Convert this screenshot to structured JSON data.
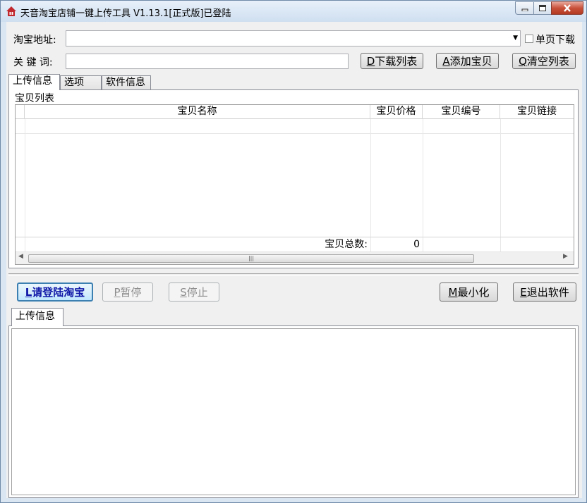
{
  "window": {
    "title": "天音淘宝店铺一键上传工具 V1.13.1[正式版]已登陆",
    "title_color": "#000000"
  },
  "top_form": {
    "shop_url_label": "淘宝地址:",
    "shop_url_value": "",
    "single_page_label": "单页下载",
    "single_page_checked": false,
    "keyword_label": "关 键 词:",
    "keyword_value": "",
    "download_list_key": "D",
    "download_list_label": "下载列表",
    "add_item_key": "A",
    "add_item_label": "添加宝贝",
    "clear_list_key": "Q",
    "clear_list_label": "清空列表"
  },
  "tabs": [
    {
      "label": "上传信息",
      "active": true
    },
    {
      "label": "选项",
      "active": false
    },
    {
      "label": "软件信息",
      "active": false
    }
  ],
  "item_list": {
    "group_label": "宝贝列表",
    "columns": [
      "宝贝名称",
      "宝贝价格",
      "宝贝编号",
      "宝贝链接"
    ],
    "rows": [],
    "total_label": "宝贝总数:",
    "total_value": "0"
  },
  "actions": {
    "login_key": "L",
    "login_label": "请登陆淘宝",
    "pause_key": "P",
    "pause_label": "暂停",
    "stop_key": "S",
    "stop_label": "停止",
    "minimize_key": "M",
    "minimize_label": "最小化",
    "exit_key": "E",
    "exit_label": "退出软件"
  },
  "log_panel": {
    "tab_label": "上传信息",
    "content": ""
  },
  "colors": {
    "accent": "#1018a8",
    "titlebar": "#cfdff0",
    "close_button": "#c8503a"
  }
}
